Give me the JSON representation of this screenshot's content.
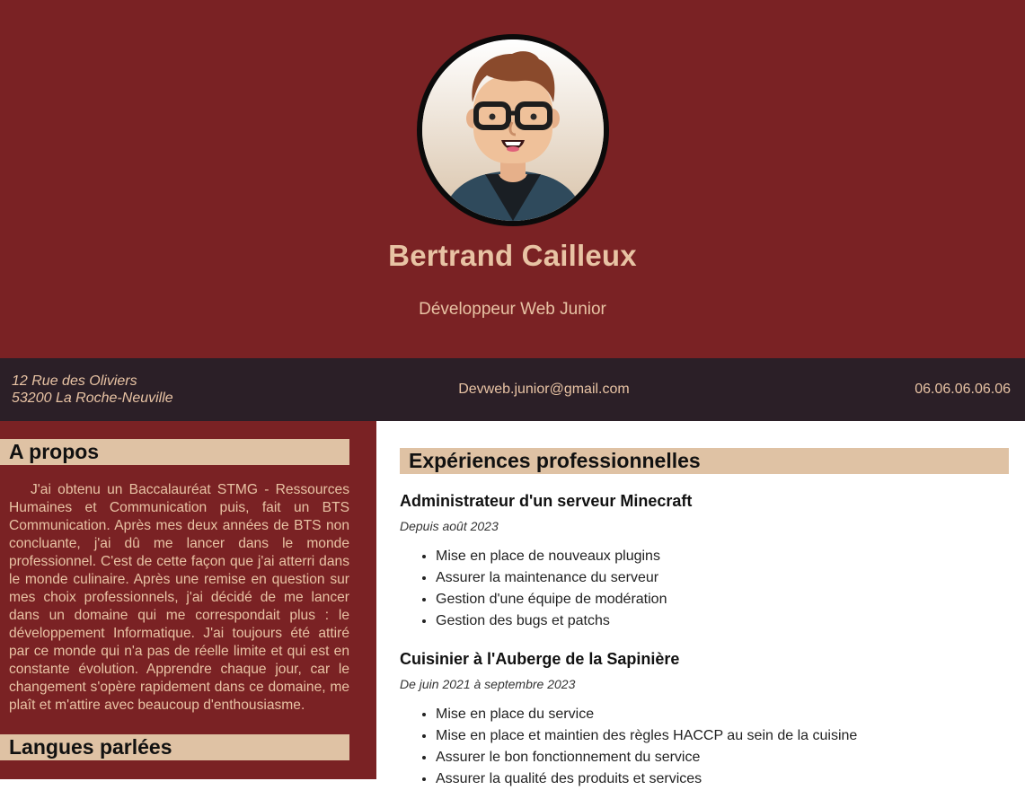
{
  "header": {
    "name": "Bertrand Cailleux",
    "role": "Développeur Web Junior"
  },
  "contact": {
    "address_line1": "12 Rue des Oliviers",
    "address_line2": "53200 La Roche-Neuville",
    "email": "Devweb.junior@gmail.com",
    "phone": "06.06.06.06.06"
  },
  "about": {
    "heading": "A propos",
    "text": "J'ai obtenu un Baccalauréat STMG - Ressources Humaines et Communication puis, fait un BTS Communication. Après mes deux années de BTS non concluante, j'ai dû me lancer dans le monde professionnel. C'est de cette façon que j'ai atterri dans le monde culinaire. Après une remise en question sur mes choix professionnels, j'ai décidé de me lancer dans un domaine qui me correspondait plus : le développement Informatique. J'ai toujours été attiré par ce monde qui n'a pas de réelle limite et qui est en constante évolution. Apprendre chaque jour, car le changement s'opère rapidement dans ce domaine, me plaît et m'attire avec beaucoup d'enthousiasme."
  },
  "languages": {
    "heading": "Langues parlées"
  },
  "experience": {
    "heading": "Expériences professionnelles",
    "jobs": [
      {
        "title": "Administrateur d'un serveur Minecraft",
        "dates": "Depuis août 2023",
        "tasks": [
          "Mise en place de nouveaux plugins",
          "Assurer la maintenance du serveur",
          "Gestion d'une équipe de modération",
          "Gestion des bugs et patchs"
        ]
      },
      {
        "title": "Cuisinier à l'Auberge de la Sapinière",
        "dates": "De juin 2021 à septembre 2023",
        "tasks": [
          "Mise en place du service",
          "Mise en place et maintien des règles HACCP au sein de la cuisine",
          "Assurer le bon fonctionnement du service",
          "Assurer la qualité des produits et services"
        ]
      }
    ]
  },
  "colors": {
    "primary": "#7a2224",
    "dark": "#2b1f27",
    "accent": "#e8c3a4",
    "heading_bg": "#dfc2a4"
  }
}
